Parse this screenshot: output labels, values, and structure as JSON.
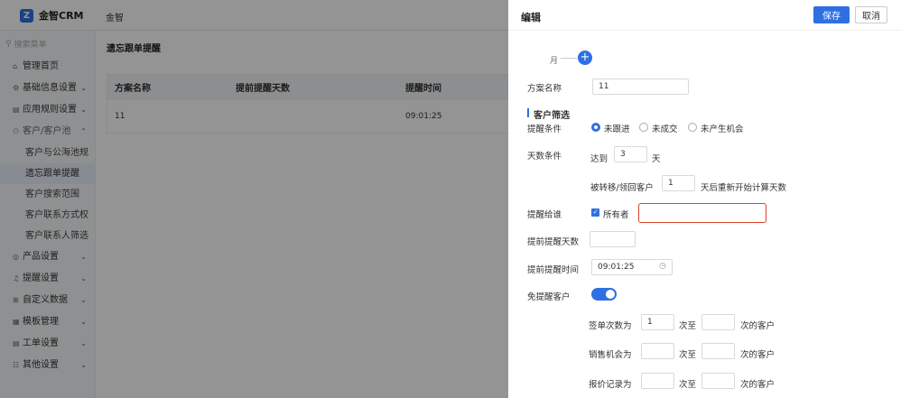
{
  "header": {
    "logo_glyph": "Z",
    "logo_text": "金智CRM",
    "breadcrumb": "金智"
  },
  "sidebar": {
    "search_placeholder": "搜索菜单",
    "items": [
      {
        "icon": "⌂",
        "label": "管理首页",
        "chevron": ""
      },
      {
        "icon": "⚙",
        "label": "基础信息设置",
        "chevron": "⌄"
      },
      {
        "icon": "▤",
        "label": "应用规则设置",
        "chevron": "⌄"
      },
      {
        "icon": "⚇",
        "label": "客户/客户池",
        "chevron": "⌃"
      },
      {
        "icon": "◎",
        "label": "产品设置",
        "chevron": "⌄"
      },
      {
        "icon": "♫",
        "label": "提醒设置",
        "chevron": "⌄"
      },
      {
        "icon": "⊞",
        "label": "自定义数据",
        "chevron": "⌄"
      },
      {
        "icon": "▦",
        "label": "模板管理",
        "chevron": "⌄"
      },
      {
        "icon": "▤",
        "label": "工单设置",
        "chevron": "⌄"
      },
      {
        "icon": "☷",
        "label": "其他设置",
        "chevron": "⌄"
      }
    ],
    "sub_items": [
      "客户与公海池规",
      "遗忘跟单提醒",
      "客户搜索范围",
      "客户联系方式权",
      "客户联系人筛选"
    ]
  },
  "main": {
    "title": "遗忘跟单提醒",
    "columns": [
      "方案名称",
      "提前提醒天数",
      "提醒时间"
    ],
    "rows": [
      {
        "name": "11",
        "days": "",
        "time": "09:01:25"
      }
    ]
  },
  "drawer": {
    "title": "编辑",
    "save": "保存",
    "cancel": "取消",
    "step_label": "月",
    "step_plus": "+",
    "plan_name_label": "方案名称",
    "plan_name_value": "11",
    "section_title": "客户筛选",
    "condition_label": "提醒条件",
    "condition_options": [
      "未跟进",
      "未成交",
      "未产生机会"
    ],
    "days_label": "天数条件",
    "days_prefix": "达到",
    "days_value": "3",
    "days_unit": "天",
    "transfer_prefix": "被转移/领回客户",
    "transfer_value": "1",
    "transfer_suffix": "天后重新开始计算天数",
    "remind_who_label": "提醒给谁",
    "owner_check_label": "所有者",
    "advance_days_label": "提前提醒天数",
    "advance_days_value": "",
    "remind_time_label": "提前提醒时间",
    "remind_time_value": "09:01:25",
    "exempt_label": "免提醒客户",
    "exempt_rows": [
      {
        "prefix": "签单次数为",
        "v1": "1",
        "mid": "次至",
        "v2": "",
        "suffix": "次的客户"
      },
      {
        "prefix": "销售机会为",
        "v1": "",
        "mid": "次至",
        "v2": "",
        "suffix": "次的客户"
      },
      {
        "prefix": "报价记录为",
        "v1": "",
        "mid": "次至",
        "v2": "",
        "suffix": "次的客户"
      }
    ]
  }
}
